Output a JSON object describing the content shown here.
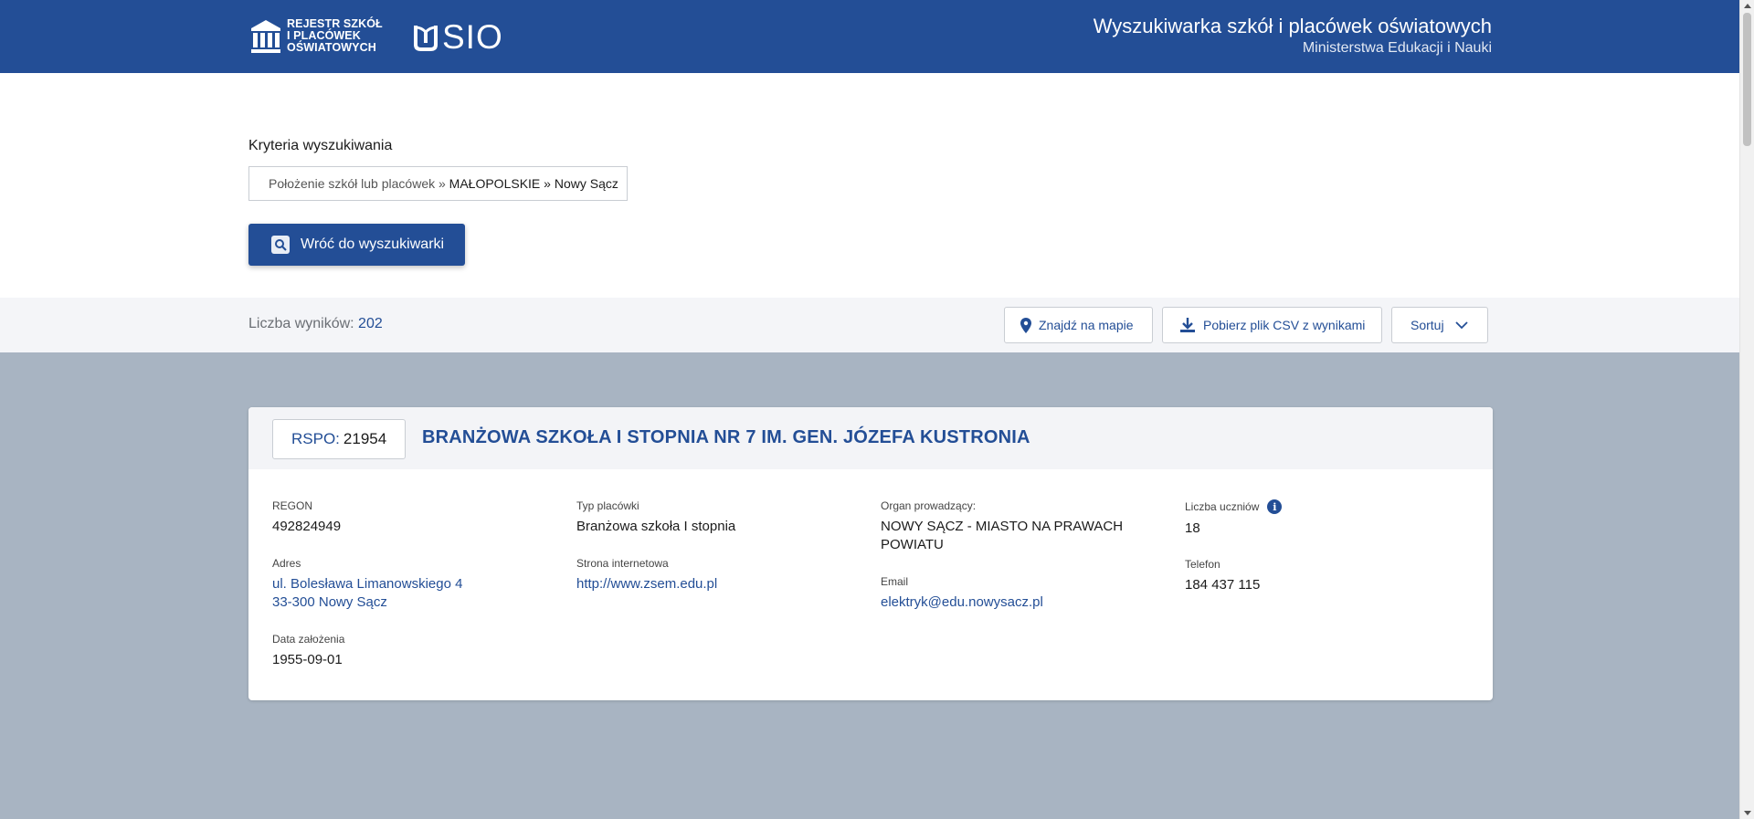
{
  "header": {
    "logo_rspo_lines": [
      "REJESTR SZKÓŁ",
      "I PLACÓWEK",
      "OŚWIATOWYCH"
    ],
    "logo_sio": "SIO",
    "title": "Wyszukiwarka szkół i placówek oświatowych",
    "subtitle": "Ministerstwa Edukacji i Nauki"
  },
  "criteria": {
    "label": "Kryteria wyszukiwania",
    "prefix": "Położenie szkół lub placówek » ",
    "value": "MAŁOPOLSKIE » Nowy Sącz"
  },
  "back_button": {
    "label": "Wróć do wyszukiwarki",
    "icon": "search-icon"
  },
  "results": {
    "count_label": "Liczba wyników: ",
    "count": "202",
    "map_button": "Znajdź na mapie",
    "csv_button": "Pobierz plik CSV z wynikami",
    "sort_button": "Sortuj"
  },
  "card": {
    "rspo_label": "RSPO:",
    "rspo_value": "21954",
    "name": "BRANŻOWA SZKOŁA I STOPNIA NR 7 IM. GEN. JÓZEFA KUSTRONIA",
    "regon_label": "REGON",
    "regon": "492824949",
    "address_label": "Adres",
    "address_line1": "ul. Bolesława Limanowskiego 4",
    "address_line2": "33-300 Nowy Sącz",
    "founded_label": "Data założenia",
    "founded": "1955-09-01",
    "type_label": "Typ placówki",
    "type": "Branżowa szkoła I stopnia",
    "website_label": "Strona internetowa",
    "website": "http://www.zsem.edu.pl",
    "organ_label": "Organ prowadzący:",
    "organ": "NOWY SĄCZ - MIASTO NA PRAWACH POWIATU",
    "email_label": "Email",
    "email": "elektryk@edu.nowysacz.pl",
    "students_label": "Liczba uczniów",
    "students": "18",
    "phone_label": "Telefon",
    "phone": "184 437 115"
  },
  "colors": {
    "brand": "#234e96",
    "gray_bg": "#a8b4c2"
  }
}
